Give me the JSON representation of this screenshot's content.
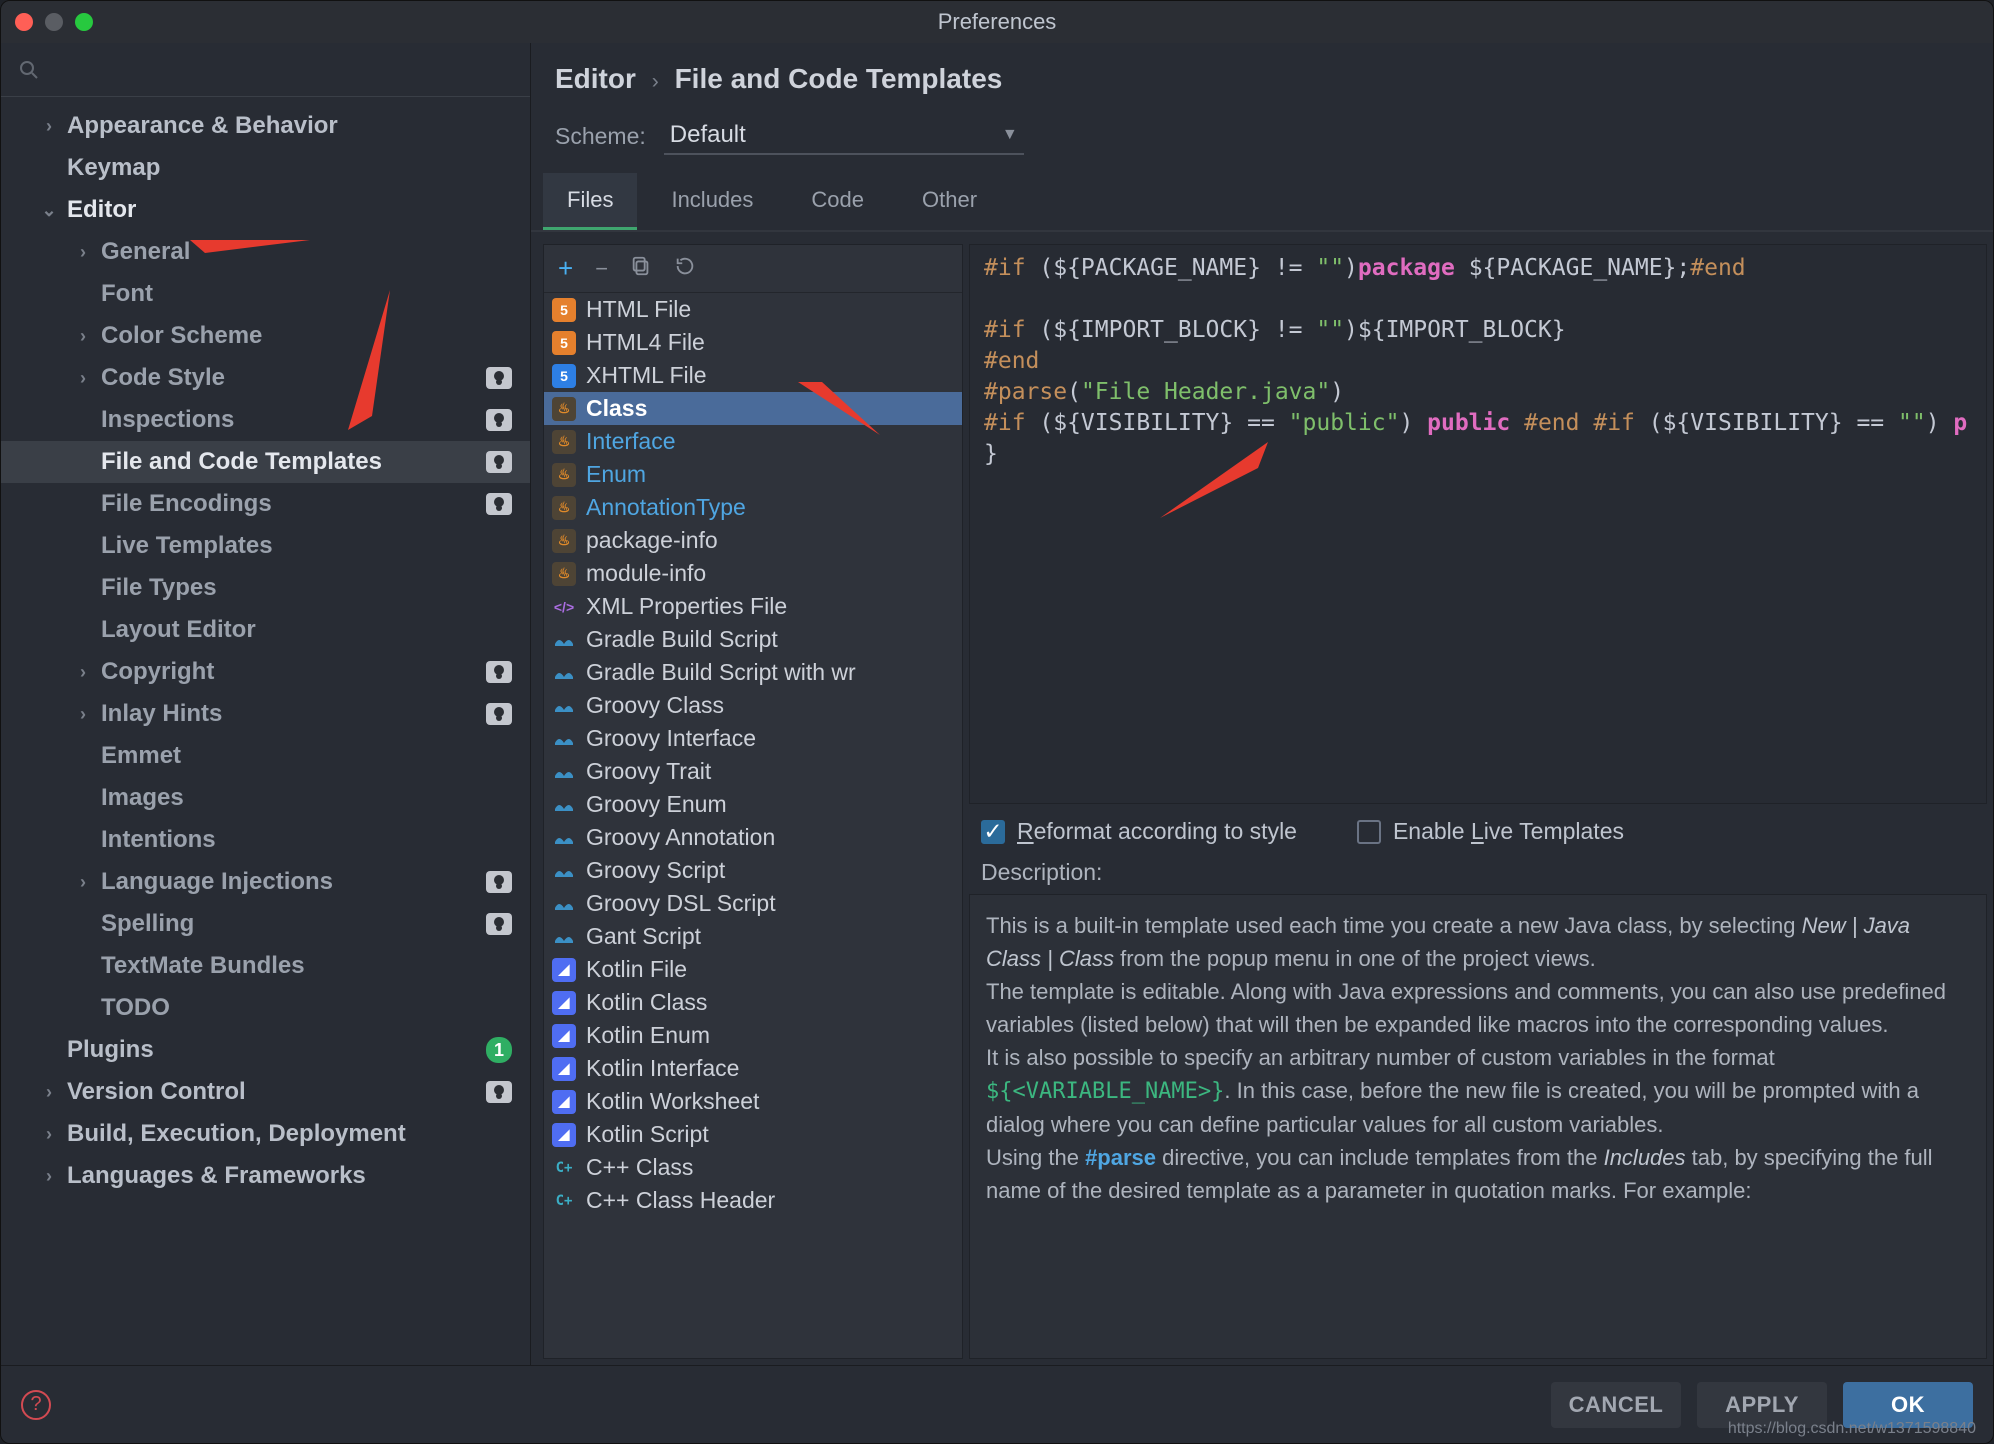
{
  "window": {
    "title": "Preferences"
  },
  "breadcrumb": {
    "a": "Editor",
    "b": "File and Code Templates"
  },
  "scheme": {
    "label": "Scheme:",
    "value": "Default"
  },
  "tabs": {
    "files": "Files",
    "includes": "Includes",
    "code": "Code",
    "other": "Other"
  },
  "sidebar": {
    "items": [
      {
        "label": "Appearance & Behavior",
        "depth": 0,
        "chev": ">",
        "bold": true
      },
      {
        "label": "Keymap",
        "depth": 0,
        "bold": true
      },
      {
        "label": "Editor",
        "depth": 0,
        "chev": "v",
        "bold": true,
        "active": true
      },
      {
        "label": "General",
        "depth": 1,
        "chev": ">"
      },
      {
        "label": "Font",
        "depth": 1
      },
      {
        "label": "Color Scheme",
        "depth": 1,
        "chev": ">"
      },
      {
        "label": "Code Style",
        "depth": 1,
        "chev": ">",
        "badge": true
      },
      {
        "label": "Inspections",
        "depth": 1,
        "badge": true
      },
      {
        "label": "File and Code Templates",
        "depth": 1,
        "badge": true,
        "selected": true
      },
      {
        "label": "File Encodings",
        "depth": 1,
        "badge": true
      },
      {
        "label": "Live Templates",
        "depth": 1
      },
      {
        "label": "File Types",
        "depth": 1
      },
      {
        "label": "Layout Editor",
        "depth": 1
      },
      {
        "label": "Copyright",
        "depth": 1,
        "chev": ">",
        "badge": true
      },
      {
        "label": "Inlay Hints",
        "depth": 1,
        "chev": ">",
        "badge": true
      },
      {
        "label": "Emmet",
        "depth": 1
      },
      {
        "label": "Images",
        "depth": 1
      },
      {
        "label": "Intentions",
        "depth": 1
      },
      {
        "label": "Language Injections",
        "depth": 1,
        "chev": ">",
        "badge": true
      },
      {
        "label": "Spelling",
        "depth": 1,
        "badge": true
      },
      {
        "label": "TextMate Bundles",
        "depth": 1
      },
      {
        "label": "TODO",
        "depth": 1
      },
      {
        "label": "Plugins",
        "depth": 0,
        "bold": true,
        "num": "1"
      },
      {
        "label": "Version Control",
        "depth": 0,
        "chev": ">",
        "bold": true,
        "badge": true
      },
      {
        "label": "Build, Execution, Deployment",
        "depth": 0,
        "chev": ">",
        "bold": true
      },
      {
        "label": "Languages & Frameworks",
        "depth": 0,
        "chev": ">",
        "bold": true
      }
    ]
  },
  "templates": [
    {
      "label": "HTML File",
      "icon": "html"
    },
    {
      "label": "HTML4 File",
      "icon": "html"
    },
    {
      "label": "XHTML File",
      "icon": "xhtml"
    },
    {
      "label": "Class",
      "icon": "java",
      "selected": true,
      "blue": true
    },
    {
      "label": "Interface",
      "icon": "java",
      "blue": true
    },
    {
      "label": "Enum",
      "icon": "java",
      "blue": true
    },
    {
      "label": "AnnotationType",
      "icon": "java",
      "blue": true
    },
    {
      "label": "package-info",
      "icon": "java"
    },
    {
      "label": "module-info",
      "icon": "java"
    },
    {
      "label": "XML Properties File",
      "icon": "xml"
    },
    {
      "label": "Gradle Build Script",
      "icon": "groovy"
    },
    {
      "label": "Gradle Build Script with wr",
      "icon": "groovy"
    },
    {
      "label": "Groovy Class",
      "icon": "groovy"
    },
    {
      "label": "Groovy Interface",
      "icon": "groovy"
    },
    {
      "label": "Groovy Trait",
      "icon": "groovy"
    },
    {
      "label": "Groovy Enum",
      "icon": "groovy"
    },
    {
      "label": "Groovy Annotation",
      "icon": "groovy"
    },
    {
      "label": "Groovy Script",
      "icon": "groovy"
    },
    {
      "label": "Groovy DSL Script",
      "icon": "groovy"
    },
    {
      "label": "Gant Script",
      "icon": "groovy"
    },
    {
      "label": "Kotlin File",
      "icon": "kotlin"
    },
    {
      "label": "Kotlin Class",
      "icon": "kotlin"
    },
    {
      "label": "Kotlin Enum",
      "icon": "kotlin"
    },
    {
      "label": "Kotlin Interface",
      "icon": "kotlin"
    },
    {
      "label": "Kotlin Worksheet",
      "icon": "kotlin"
    },
    {
      "label": "Kotlin Script",
      "icon": "kotlin"
    },
    {
      "label": "C++ Class",
      "icon": "cpp"
    },
    {
      "label": "C++ Class Header",
      "icon": "cpp"
    }
  ],
  "code": {
    "l1a": "#if",
    "l1b": " (${PACKAGE_NAME} != ",
    "l1s": "\"\"",
    "l1c": ")",
    "l1kw": "package",
    "l1d": " ${PACKAGE_NAME};",
    "l1e": "#end",
    "l2a": "#if",
    "l2b": " (${IMPORT_BLOCK} != ",
    "l2s": "\"\"",
    "l2c": ")${IMPORT_BLOCK}",
    "l3": "#end",
    "l4a": "#parse",
    "l4b": "(",
    "l4s": "\"File Header.java\"",
    "l4c": ")",
    "l5a": "#if",
    "l5b": " (${VISIBILITY} == ",
    "l5s": "\"public\"",
    "l5c": ") ",
    "l5kw": "public",
    "l5d": " ",
    "l5e": "#end",
    "l5f": " ",
    "l5g": "#if",
    "l5h": " (${VISIBILITY} == ",
    "l5s2": "\"\"",
    "l5i": ") ",
    "l5tail": "p",
    "l6": "}"
  },
  "checks": {
    "reformat": "Reformat according to style",
    "liveTemplates": "Enable Live Templates"
  },
  "desc": {
    "label": "Description:",
    "p1a": "This is a built-in template used each time you create a new Java class, by selecting ",
    "p1i": "New | Java Class | Class",
    "p1b": " from the popup menu in one of the project views.",
    "p2": "The template is editable. Along with Java expressions and comments, you can also use predefined variables (listed below) that will then be expanded like macros into the corresponding values.",
    "p3a": "It is also possible to specify an arbitrary number of custom variables in the format ",
    "p3code": "${<VARIABLE_NAME>}",
    "p3b": ". In this case, before the new file is created, you will be prompted with a dialog where you can define particular values for all custom variables.",
    "p4a": "Using the ",
    "p4parse": "#parse",
    "p4b": " directive, you can include templates from the ",
    "p4i": "Includes",
    "p4c": " tab, by specifying the full name of the desired template as a parameter in quotation marks. For example:"
  },
  "buttons": {
    "cancel": "CANCEL",
    "apply": "APPLY",
    "ok": "OK"
  },
  "watermark": "https://blog.csdn.net/w1371598840"
}
